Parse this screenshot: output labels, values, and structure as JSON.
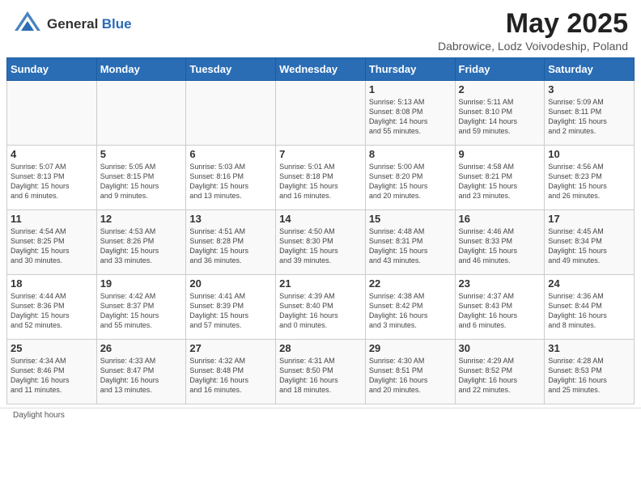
{
  "header": {
    "logo": {
      "general": "General",
      "blue": "Blue"
    },
    "title": "May 2025",
    "subtitle": "Dabrowice, Lodz Voivodeship, Poland"
  },
  "days_of_week": [
    "Sunday",
    "Monday",
    "Tuesday",
    "Wednesday",
    "Thursday",
    "Friday",
    "Saturday"
  ],
  "weeks": [
    [
      {
        "day": "",
        "info": ""
      },
      {
        "day": "",
        "info": ""
      },
      {
        "day": "",
        "info": ""
      },
      {
        "day": "",
        "info": ""
      },
      {
        "day": "1",
        "info": "Sunrise: 5:13 AM\nSunset: 8:08 PM\nDaylight: 14 hours\nand 55 minutes."
      },
      {
        "day": "2",
        "info": "Sunrise: 5:11 AM\nSunset: 8:10 PM\nDaylight: 14 hours\nand 59 minutes."
      },
      {
        "day": "3",
        "info": "Sunrise: 5:09 AM\nSunset: 8:11 PM\nDaylight: 15 hours\nand 2 minutes."
      }
    ],
    [
      {
        "day": "4",
        "info": "Sunrise: 5:07 AM\nSunset: 8:13 PM\nDaylight: 15 hours\nand 6 minutes."
      },
      {
        "day": "5",
        "info": "Sunrise: 5:05 AM\nSunset: 8:15 PM\nDaylight: 15 hours\nand 9 minutes."
      },
      {
        "day": "6",
        "info": "Sunrise: 5:03 AM\nSunset: 8:16 PM\nDaylight: 15 hours\nand 13 minutes."
      },
      {
        "day": "7",
        "info": "Sunrise: 5:01 AM\nSunset: 8:18 PM\nDaylight: 15 hours\nand 16 minutes."
      },
      {
        "day": "8",
        "info": "Sunrise: 5:00 AM\nSunset: 8:20 PM\nDaylight: 15 hours\nand 20 minutes."
      },
      {
        "day": "9",
        "info": "Sunrise: 4:58 AM\nSunset: 8:21 PM\nDaylight: 15 hours\nand 23 minutes."
      },
      {
        "day": "10",
        "info": "Sunrise: 4:56 AM\nSunset: 8:23 PM\nDaylight: 15 hours\nand 26 minutes."
      }
    ],
    [
      {
        "day": "11",
        "info": "Sunrise: 4:54 AM\nSunset: 8:25 PM\nDaylight: 15 hours\nand 30 minutes."
      },
      {
        "day": "12",
        "info": "Sunrise: 4:53 AM\nSunset: 8:26 PM\nDaylight: 15 hours\nand 33 minutes."
      },
      {
        "day": "13",
        "info": "Sunrise: 4:51 AM\nSunset: 8:28 PM\nDaylight: 15 hours\nand 36 minutes."
      },
      {
        "day": "14",
        "info": "Sunrise: 4:50 AM\nSunset: 8:30 PM\nDaylight: 15 hours\nand 39 minutes."
      },
      {
        "day": "15",
        "info": "Sunrise: 4:48 AM\nSunset: 8:31 PM\nDaylight: 15 hours\nand 43 minutes."
      },
      {
        "day": "16",
        "info": "Sunrise: 4:46 AM\nSunset: 8:33 PM\nDaylight: 15 hours\nand 46 minutes."
      },
      {
        "day": "17",
        "info": "Sunrise: 4:45 AM\nSunset: 8:34 PM\nDaylight: 15 hours\nand 49 minutes."
      }
    ],
    [
      {
        "day": "18",
        "info": "Sunrise: 4:44 AM\nSunset: 8:36 PM\nDaylight: 15 hours\nand 52 minutes."
      },
      {
        "day": "19",
        "info": "Sunrise: 4:42 AM\nSunset: 8:37 PM\nDaylight: 15 hours\nand 55 minutes."
      },
      {
        "day": "20",
        "info": "Sunrise: 4:41 AM\nSunset: 8:39 PM\nDaylight: 15 hours\nand 57 minutes."
      },
      {
        "day": "21",
        "info": "Sunrise: 4:39 AM\nSunset: 8:40 PM\nDaylight: 16 hours\nand 0 minutes."
      },
      {
        "day": "22",
        "info": "Sunrise: 4:38 AM\nSunset: 8:42 PM\nDaylight: 16 hours\nand 3 minutes."
      },
      {
        "day": "23",
        "info": "Sunrise: 4:37 AM\nSunset: 8:43 PM\nDaylight: 16 hours\nand 6 minutes."
      },
      {
        "day": "24",
        "info": "Sunrise: 4:36 AM\nSunset: 8:44 PM\nDaylight: 16 hours\nand 8 minutes."
      }
    ],
    [
      {
        "day": "25",
        "info": "Sunrise: 4:34 AM\nSunset: 8:46 PM\nDaylight: 16 hours\nand 11 minutes."
      },
      {
        "day": "26",
        "info": "Sunrise: 4:33 AM\nSunset: 8:47 PM\nDaylight: 16 hours\nand 13 minutes."
      },
      {
        "day": "27",
        "info": "Sunrise: 4:32 AM\nSunset: 8:48 PM\nDaylight: 16 hours\nand 16 minutes."
      },
      {
        "day": "28",
        "info": "Sunrise: 4:31 AM\nSunset: 8:50 PM\nDaylight: 16 hours\nand 18 minutes."
      },
      {
        "day": "29",
        "info": "Sunrise: 4:30 AM\nSunset: 8:51 PM\nDaylight: 16 hours\nand 20 minutes."
      },
      {
        "day": "30",
        "info": "Sunrise: 4:29 AM\nSunset: 8:52 PM\nDaylight: 16 hours\nand 22 minutes."
      },
      {
        "day": "31",
        "info": "Sunrise: 4:28 AM\nSunset: 8:53 PM\nDaylight: 16 hours\nand 25 minutes."
      }
    ]
  ],
  "footer": {
    "daylight_label": "Daylight hours"
  }
}
